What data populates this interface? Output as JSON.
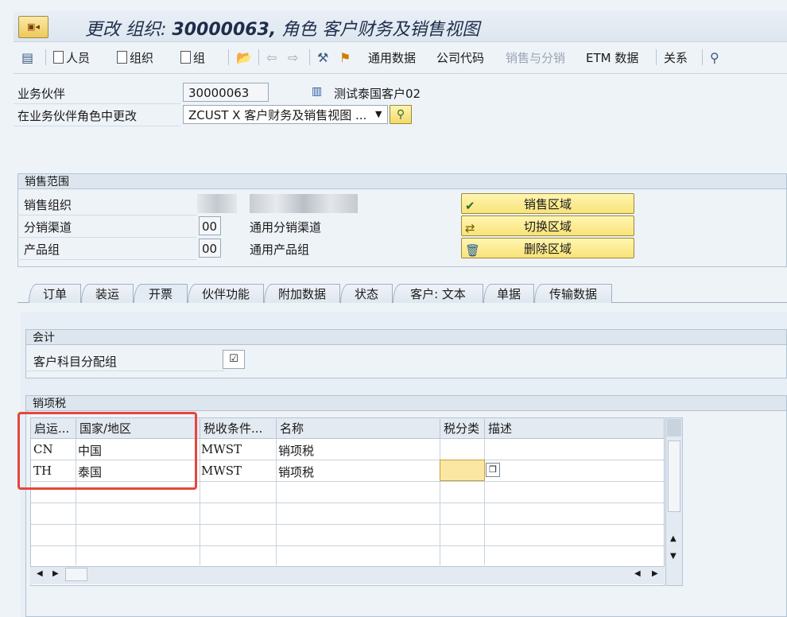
{
  "window": {
    "title_prefix": "更改 组织:",
    "title_id": "30000063,",
    "title_suffix": "角色 客户财务及销售视图"
  },
  "toolbar": {
    "person": "人员",
    "org": "组织",
    "group": "组",
    "general_data": "通用数据",
    "company_code": "公司代码",
    "sales_dist": "销售与分销",
    "etm": "ETM 数据",
    "relations": "关系"
  },
  "header": {
    "bp_label": "业务伙伴",
    "bp_value": "30000063",
    "bp_desc": "测试泰国客户02",
    "role_label": "在业务伙伴角色中更改",
    "role_value": "ZCUST X 客户财务及销售视图 ..."
  },
  "sales_area": {
    "title": "销售范围",
    "org_label": "销售组织",
    "channel_label": "分销渠道",
    "channel_value": "00",
    "channel_desc": "通用分销渠道",
    "division_label": "产品组",
    "division_value": "00",
    "division_desc": "通用产品组",
    "btn_sales_area": "销售区域",
    "btn_switch": "切换区域",
    "btn_delete": "删除区域"
  },
  "tabs": [
    "订单",
    "装运",
    "开票",
    "伙伴功能",
    "附加数据",
    "状态",
    "客户: 文本",
    "单据",
    "传输数据"
  ],
  "active_tab": "开票",
  "accounting": {
    "title": "会计",
    "acct_group_label": "客户科目分配组"
  },
  "tax": {
    "title": "销项税",
    "columns": [
      "启运...",
      "国家/地区",
      "税收条件...",
      "名称",
      "税分类",
      "描述"
    ],
    "rows": [
      {
        "country": "CN",
        "country_name": "中国",
        "cond": "MWST",
        "name": "销项税",
        "class": "",
        "desc": ""
      },
      {
        "country": "TH",
        "country_name": "泰国",
        "cond": "MWST",
        "name": "销项税",
        "class": "",
        "desc": ""
      }
    ]
  },
  "colors": {
    "highlight_box": "#e8453c",
    "input_yellow": "#fbe7a1",
    "button_yellow": "#f8e37a"
  }
}
